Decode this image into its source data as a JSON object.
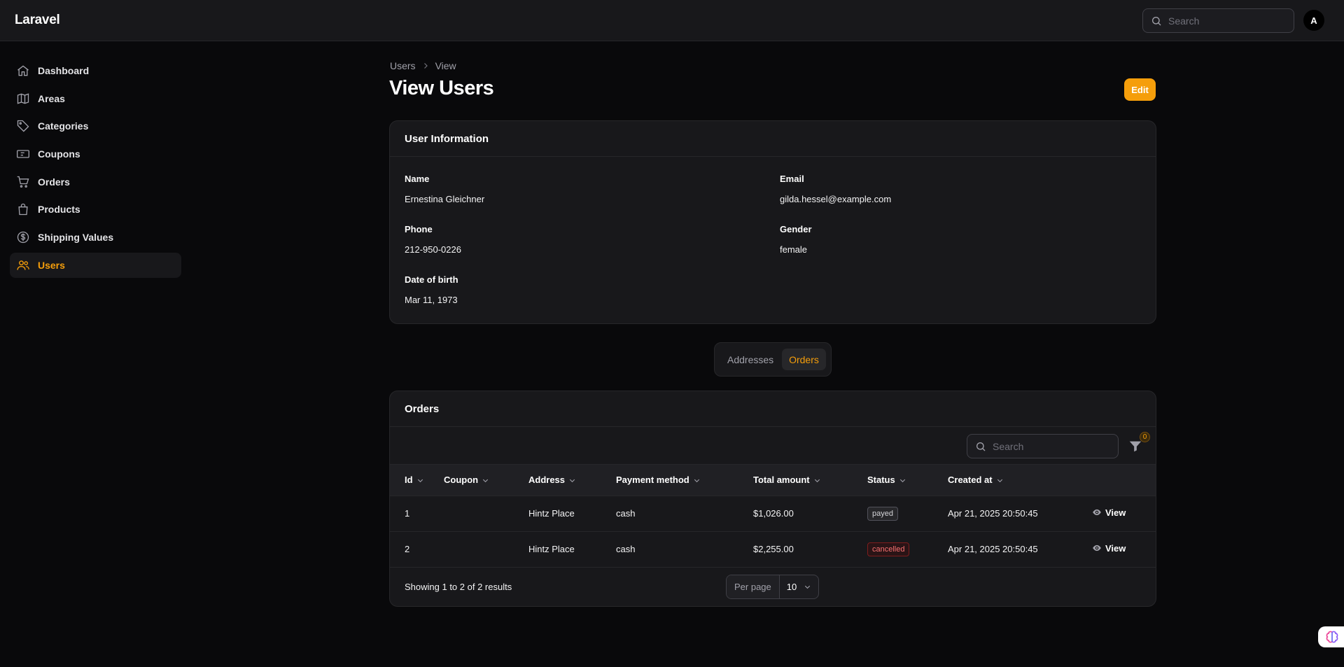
{
  "app": {
    "brand": "Laravel",
    "avatar_initial": "A"
  },
  "topbar": {
    "search_placeholder": "Search"
  },
  "sidebar": {
    "items": [
      {
        "label": "Dashboard",
        "icon": "home-icon"
      },
      {
        "label": "Areas",
        "icon": "map-icon"
      },
      {
        "label": "Categories",
        "icon": "tag-icon"
      },
      {
        "label": "Coupons",
        "icon": "ticket-icon"
      },
      {
        "label": "Orders",
        "icon": "cart-icon"
      },
      {
        "label": "Products",
        "icon": "shopping-bag-icon"
      },
      {
        "label": "Shipping Values",
        "icon": "dollar-circle-icon"
      },
      {
        "label": "Users",
        "icon": "users-icon",
        "active": true
      }
    ]
  },
  "breadcrumb": {
    "parent": "Users",
    "current": "View"
  },
  "page": {
    "title": "View Users",
    "edit_label": "Edit"
  },
  "user_info": {
    "heading": "User Information",
    "name_label": "Name",
    "name": "Ernestina Gleichner",
    "email_label": "Email",
    "email": "gilda.hessel@example.com",
    "phone_label": "Phone",
    "phone": "212-950-0226",
    "gender_label": "Gender",
    "gender": "female",
    "dob_label": "Date of birth",
    "dob": "Mar 11, 1973"
  },
  "tabs": {
    "addresses": "Addresses",
    "orders": "Orders",
    "active": "orders"
  },
  "orders": {
    "heading": "Orders",
    "search_placeholder": "Search",
    "filter_count": "0",
    "columns": [
      "Id",
      "Coupon",
      "Address",
      "Payment method",
      "Total amount",
      "Status",
      "Created at"
    ],
    "rows": [
      {
        "id": "1",
        "coupon": "",
        "address": "Hintz Place",
        "payment": "cash",
        "total": "$1,026.00",
        "status": "payed",
        "created": "Apr 21, 2025 20:50:45",
        "action": "View"
      },
      {
        "id": "2",
        "coupon": "",
        "address": "Hintz Place",
        "payment": "cash",
        "total": "$2,255.00",
        "status": "cancelled",
        "created": "Apr 21, 2025 20:50:45",
        "action": "View"
      }
    ],
    "summary": "Showing 1 to 2 of 2 results",
    "per_page_label": "Per page",
    "per_page_value": "10"
  },
  "colors": {
    "accent": "#f59e0b",
    "background": "#09090b",
    "surface": "#18181b",
    "danger": "#f87171"
  }
}
